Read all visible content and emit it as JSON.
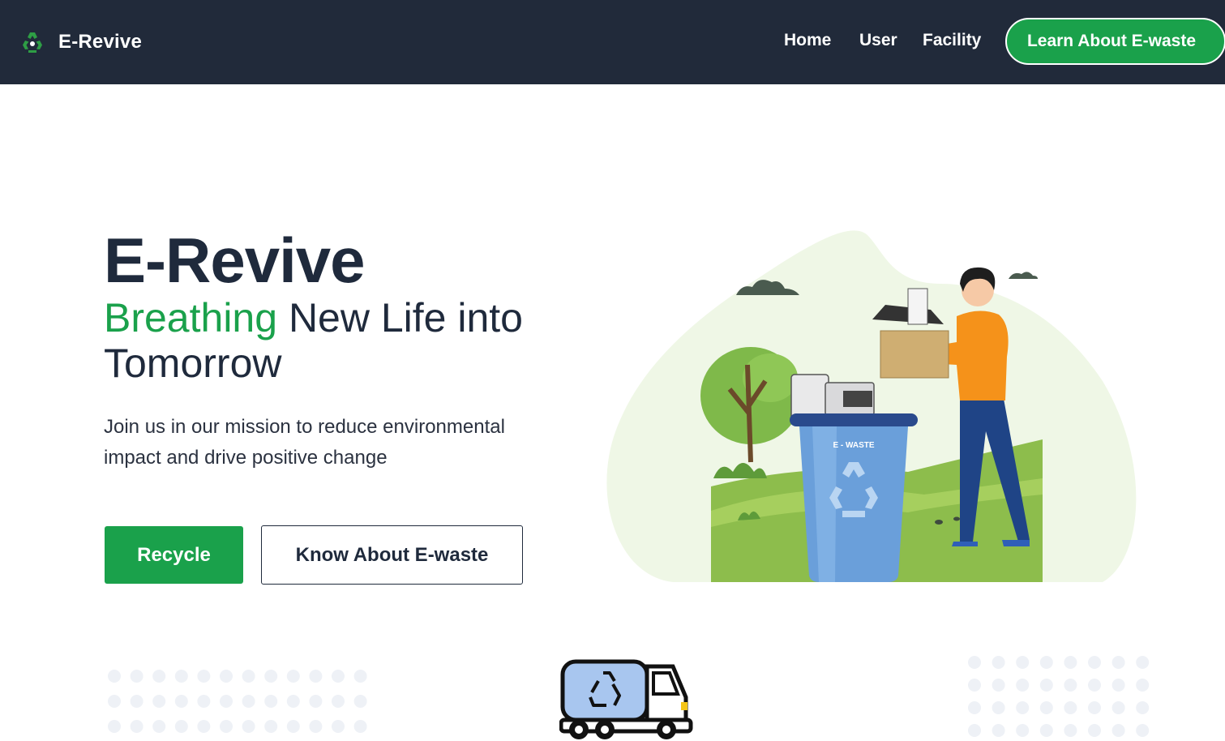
{
  "navbar": {
    "brand_name": "E-Revive",
    "logo_icon": "recycle-icon",
    "links": {
      "home": "Home",
      "user": "User",
      "facility": "Facility"
    },
    "cta_label": "Learn About E-waste"
  },
  "hero": {
    "title": "E-Revive",
    "subtitle_accent": "Breathing",
    "subtitle_rest": " New Life into Tomorrow",
    "description": "Join us in our mission to reduce environmental impact and drive positive change",
    "primary_button": "Recycle",
    "secondary_button": "Know About E-waste",
    "illustration_bin_label": "E - WASTE"
  },
  "colors": {
    "navbar_bg": "#212a3a",
    "accent_green": "#1aa14b",
    "heading_dark": "#1f2a3c",
    "blob_light_green": "#eff7e6",
    "dot_grey": "#eef1f6"
  },
  "icons": [
    "recycle-icon",
    "recycling-truck-icon"
  ]
}
